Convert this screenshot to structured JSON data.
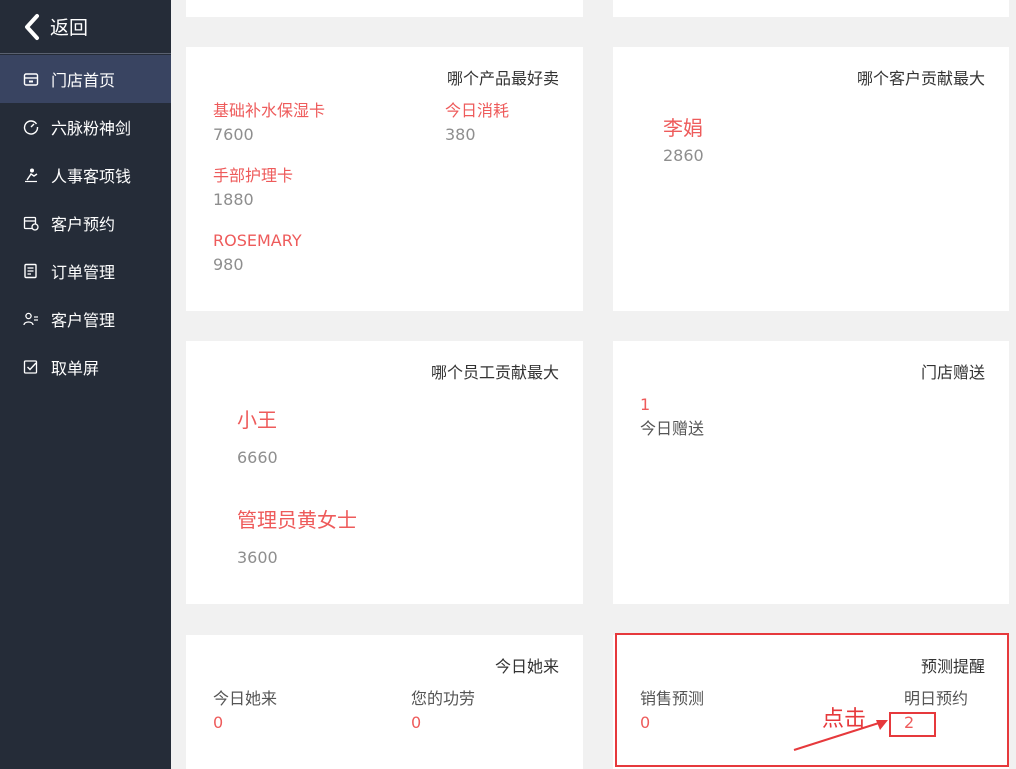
{
  "sidebar": {
    "back_label": "返回",
    "items": [
      {
        "label": "门店首页",
        "icon": "store-icon",
        "active": true
      },
      {
        "label": "六脉粉神剑",
        "icon": "gauge-icon",
        "active": false
      },
      {
        "label": "人事客项钱",
        "icon": "staff-icon",
        "active": false
      },
      {
        "label": "客户预约",
        "icon": "calendar-icon",
        "active": false
      },
      {
        "label": "订单管理",
        "icon": "order-icon",
        "active": false
      },
      {
        "label": "客户管理",
        "icon": "customer-icon",
        "active": false
      },
      {
        "label": "取单屏",
        "icon": "checklist-icon",
        "active": false
      }
    ]
  },
  "products": {
    "title": "哪个产品最好卖",
    "items": [
      {
        "name": "基础补水保湿卡",
        "value": "7600"
      },
      {
        "name": "今日消耗",
        "value": "380"
      },
      {
        "name": "手部护理卡",
        "value": "1880"
      },
      {
        "name": "ROSEMARY",
        "value": "980"
      }
    ]
  },
  "customers": {
    "title": "哪个客户贡献最大",
    "items": [
      {
        "name": "李娟",
        "value": "2860"
      }
    ]
  },
  "employees": {
    "title": "哪个员工贡献最大",
    "items": [
      {
        "name": "小王",
        "value": "6660"
      },
      {
        "name": "管理员黄女士",
        "value": "3600"
      }
    ]
  },
  "gifts": {
    "title": "门店赠送",
    "count": "1",
    "label": "今日赠送"
  },
  "today": {
    "title": "今日她来",
    "items": [
      {
        "label": "今日她来",
        "value": "0"
      },
      {
        "label": "您的功劳",
        "value": "0"
      }
    ]
  },
  "forecast": {
    "title": "预测提醒",
    "items": [
      {
        "label": "销售预测",
        "value": "0"
      },
      {
        "label": "明日预约",
        "value": "2"
      }
    ]
  },
  "annotation": {
    "text": "点击"
  },
  "colors": {
    "sidebar_bg": "#252c38",
    "sidebar_active": "#394461",
    "accent_red": "#ee5b5b",
    "annotation_red": "#e6393c",
    "page_bg": "#f1f1f1"
  }
}
